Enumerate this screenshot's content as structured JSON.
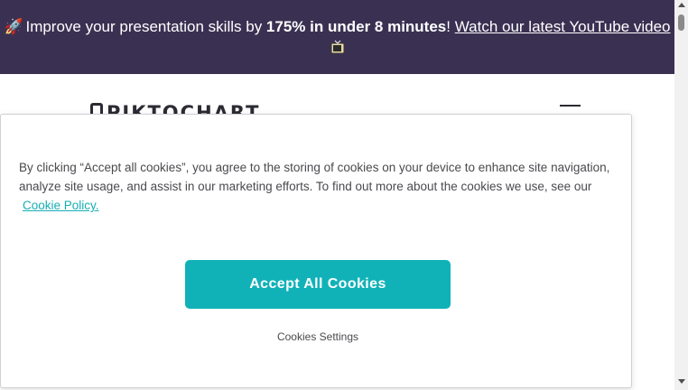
{
  "banner": {
    "rocket_icon": "🚀",
    "text_before": "Improve your presentation skills by ",
    "highlight": "175% in under 8 minutes",
    "punct": "!",
    "link_text": "Watch our latest YouTube video",
    "tv_icon": "tv-icon",
    "bg_color": "#3a3152"
  },
  "header": {
    "logo_text": "PIKTOCHART"
  },
  "cookie": {
    "text": "By clicking “Accept all cookies”, you agree to the storing of cookies on your device to enhance site navigation, analyze site usage, and assist in our marketing efforts. To find out more about the cookies we use, see our",
    "policy_link": "Cookie Policy.",
    "accept_label": "Accept All Cookies",
    "settings_label": "Cookies Settings",
    "accent_color": "#10b2b8"
  }
}
